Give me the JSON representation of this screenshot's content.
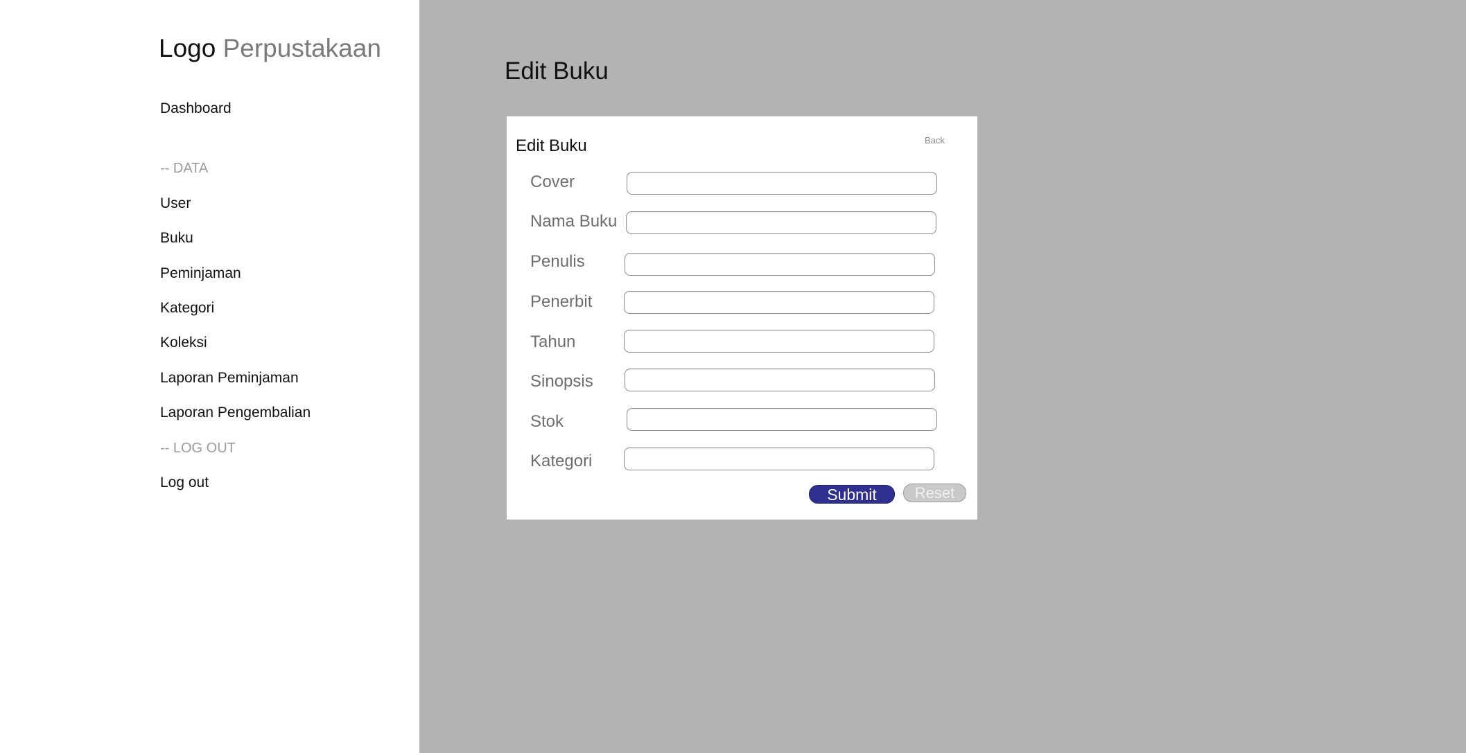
{
  "sidebar": {
    "logo": {
      "primary": "Logo",
      "secondary": "Perpustakaan"
    },
    "dashboard": "Dashboard",
    "section_data": "-- DATA",
    "items": [
      "User",
      "Buku",
      "Peminjaman",
      "Kategori",
      "Koleksi",
      "Laporan Peminjaman",
      "Laporan Pengembalian"
    ],
    "section_logout": "-- LOG OUT",
    "logout": "Log out"
  },
  "main": {
    "page_title": "Edit Buku",
    "card": {
      "title": "Edit Buku",
      "back_label": "Back",
      "fields": [
        {
          "label": "Cover",
          "value": ""
        },
        {
          "label": "Nama Buku",
          "value": ""
        },
        {
          "label": "Penulis",
          "value": ""
        },
        {
          "label": "Penerbit",
          "value": ""
        },
        {
          "label": "Tahun",
          "value": ""
        },
        {
          "label": "Sinopsis",
          "value": ""
        },
        {
          "label": "Stok",
          "value": ""
        },
        {
          "label": "Kategori",
          "value": ""
        }
      ],
      "submit_label": "Submit",
      "reset_label": "Reset"
    }
  },
  "colors": {
    "main_background": "#b3b3b3",
    "submit_button": "#2e2f8f",
    "reset_button": "#c9c9c9",
    "section_label": "#9a9a9a"
  }
}
